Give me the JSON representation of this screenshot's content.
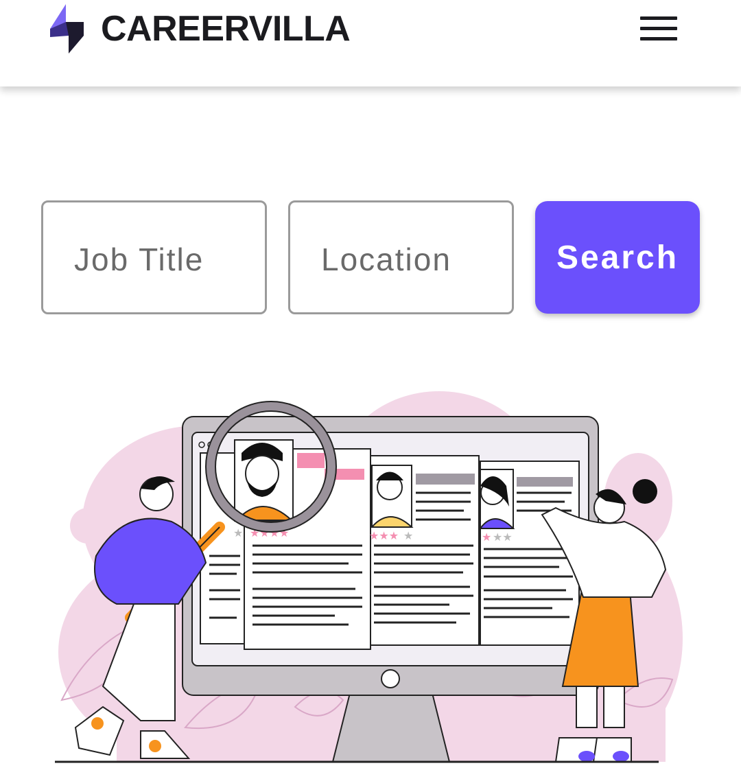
{
  "header": {
    "brand": "CAREERVILLA",
    "logo_icon": "careervilla-logo-icon",
    "menu_icon": "hamburger-menu-icon"
  },
  "search": {
    "job_title_placeholder": "Job Title",
    "location_placeholder": "Location",
    "button_label": "Search"
  },
  "illustration": {
    "description_icon": "recruiter-resume-search-illustration"
  },
  "colors": {
    "accent": "#6b50fc",
    "text": "#1b1b1f",
    "field_border": "#9a9a9a",
    "blob_pink": "#f3d7e7",
    "orange": "#f7931e",
    "monitor_grey": "#c8c3c8"
  }
}
